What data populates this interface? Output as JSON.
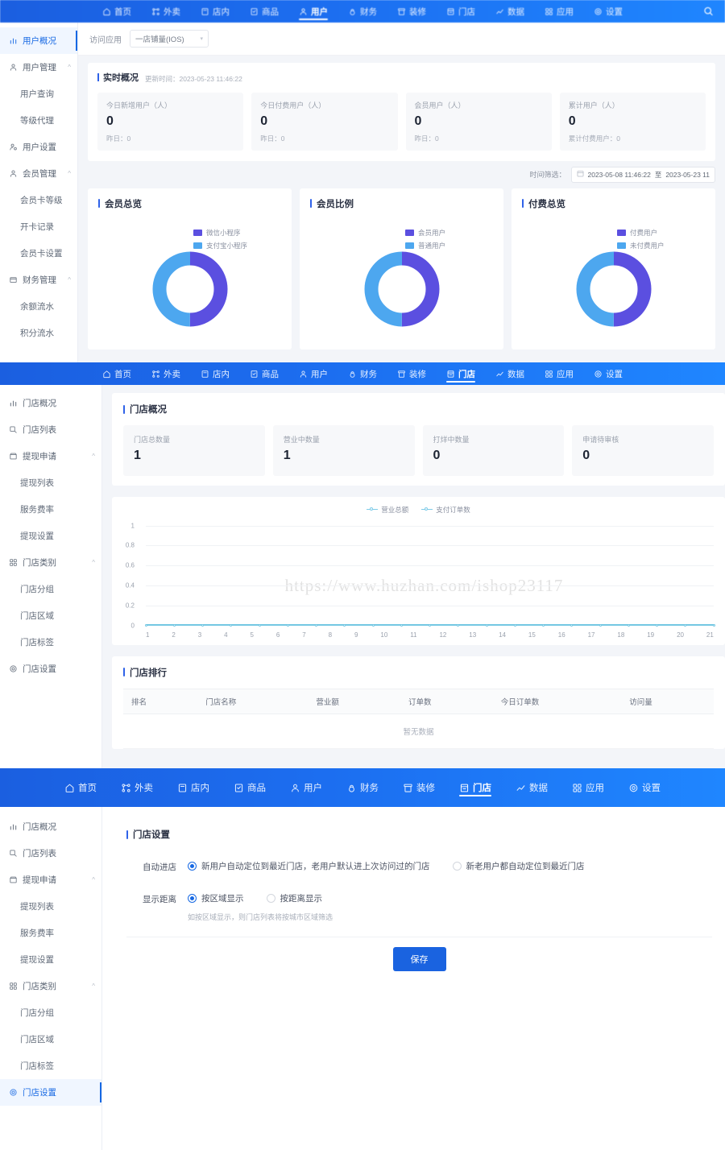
{
  "nav": {
    "items": [
      {
        "label": "首页",
        "icon": "home-icon"
      },
      {
        "label": "外卖",
        "icon": "takeout-icon"
      },
      {
        "label": "店内",
        "icon": "instore-icon"
      },
      {
        "label": "商品",
        "icon": "goods-icon"
      },
      {
        "label": "用户",
        "icon": "user-icon"
      },
      {
        "label": "财务",
        "icon": "finance-icon"
      },
      {
        "label": "装修",
        "icon": "decorate-icon"
      },
      {
        "label": "门店",
        "icon": "store-icon"
      },
      {
        "label": "数据",
        "icon": "data-icon"
      },
      {
        "label": "应用",
        "icon": "apps-icon"
      },
      {
        "label": "设置",
        "icon": "gear-icon"
      }
    ],
    "search_icon": "search-icon"
  },
  "panel1": {
    "active_nav": "用户",
    "sidebar": [
      {
        "label": "用户概况",
        "icon": "overview-icon",
        "level": "top",
        "active": true
      },
      {
        "label": "用户管理",
        "icon": "users-icon",
        "level": "top",
        "caret": "^"
      },
      {
        "label": "用户查询",
        "level": "child"
      },
      {
        "label": "等级代理",
        "level": "child"
      },
      {
        "label": "用户设置",
        "icon": "user-setting-icon",
        "level": "top"
      },
      {
        "label": "会员管理",
        "icon": "vip-icon",
        "level": "top",
        "caret": "^"
      },
      {
        "label": "会员卡等级",
        "level": "child"
      },
      {
        "label": "开卡记录",
        "level": "child"
      },
      {
        "label": "会员卡设置",
        "level": "child"
      },
      {
        "label": "财务管理",
        "icon": "finance-side-icon",
        "level": "top",
        "caret": "^"
      },
      {
        "label": "余额流水",
        "level": "child"
      },
      {
        "label": "积分流水",
        "level": "child"
      }
    ],
    "filter": {
      "label": "访问应用",
      "value": "一店铺量(IOS)"
    },
    "realtime": {
      "title": "实时概况",
      "updated": "更新时间：2023-05-23 11:46:22",
      "cards": [
        {
          "label": "今日新增用户（人）",
          "value": "0",
          "sub": "昨日：0"
        },
        {
          "label": "今日付费用户（人）",
          "value": "0",
          "sub": "昨日：0"
        },
        {
          "label": "会员用户（人）",
          "value": "0",
          "sub": "昨日：0"
        },
        {
          "label": "累计用户（人）",
          "value": "0",
          "sub": "累计付费用户：0"
        }
      ]
    },
    "timefilter": {
      "label": "时间筛选：",
      "start": "2023-05-08 11:46:22",
      "sep": "至",
      "end": "2023-05-23 11"
    },
    "donuts": [
      {
        "title": "会员总览",
        "legend": [
          {
            "label": "微信小程序",
            "color": "#5b4fe0"
          },
          {
            "label": "支付宝小程序",
            "color": "#4da7ef"
          }
        ],
        "values": [
          50,
          50
        ]
      },
      {
        "title": "会员比例",
        "legend": [
          {
            "label": "会员用户",
            "color": "#5b4fe0"
          },
          {
            "label": "普通用户",
            "color": "#4da7ef"
          }
        ],
        "values": [
          50,
          50
        ]
      },
      {
        "title": "付费总览",
        "legend": [
          {
            "label": "付费用户",
            "color": "#5b4fe0"
          },
          {
            "label": "未付费用户",
            "color": "#4da7ef"
          }
        ],
        "values": [
          50,
          50
        ]
      }
    ]
  },
  "panel2": {
    "active_nav": "门店",
    "sidebar": [
      {
        "label": "门店概况",
        "icon": "overview-icon",
        "level": "top"
      },
      {
        "label": "门店列表",
        "icon": "list-icon",
        "level": "top"
      },
      {
        "label": "提现申请",
        "icon": "withdraw-icon",
        "level": "top",
        "caret": "^"
      },
      {
        "label": "提现列表",
        "level": "child"
      },
      {
        "label": "服务费率",
        "level": "child"
      },
      {
        "label": "提现设置",
        "level": "child"
      },
      {
        "label": "门店类别",
        "icon": "category-icon",
        "level": "top",
        "caret": "^"
      },
      {
        "label": "门店分组",
        "level": "child"
      },
      {
        "label": "门店区域",
        "level": "child"
      },
      {
        "label": "门店标签",
        "level": "child"
      },
      {
        "label": "门店设置",
        "icon": "gear-icon",
        "level": "top"
      }
    ],
    "overview": {
      "title": "门店概况",
      "cards": [
        {
          "label": "门店总数量",
          "value": "1"
        },
        {
          "label": "营业中数量",
          "value": "1"
        },
        {
          "label": "打烊中数量",
          "value": "0"
        },
        {
          "label": "申请待审核",
          "value": "0"
        }
      ]
    },
    "watermark": "https://www.huzhan.com/ishop23117",
    "ranking": {
      "title": "门店排行",
      "columns": [
        "排名",
        "门店名称",
        "营业额",
        "订单数",
        "今日订单数",
        "访问量"
      ],
      "empty_text": "暂无数据"
    }
  },
  "panel3": {
    "active_nav": "门店",
    "sidebar": [
      {
        "label": "门店概况",
        "icon": "overview-icon",
        "level": "top"
      },
      {
        "label": "门店列表",
        "icon": "list-icon",
        "level": "top"
      },
      {
        "label": "提现申请",
        "icon": "withdraw-icon",
        "level": "top",
        "caret": "^"
      },
      {
        "label": "提现列表",
        "level": "child"
      },
      {
        "label": "服务费率",
        "level": "child"
      },
      {
        "label": "提现设置",
        "level": "child"
      },
      {
        "label": "门店类别",
        "icon": "category-icon",
        "level": "top",
        "caret": "^"
      },
      {
        "label": "门店分组",
        "level": "child"
      },
      {
        "label": "门店区域",
        "level": "child"
      },
      {
        "label": "门店标签",
        "level": "child"
      },
      {
        "label": "门店设置",
        "icon": "gear-icon",
        "level": "top",
        "active": true
      }
    ],
    "form": {
      "title": "门店设置",
      "auto_enter": {
        "label": "自动进店",
        "options": [
          {
            "label": "新用户自动定位到最近门店，老用户默认进上次访问过的门店",
            "selected": true
          },
          {
            "label": "新老用户都自动定位到最近门店",
            "selected": false
          }
        ]
      },
      "show_distance": {
        "label": "显示距离",
        "options": [
          {
            "label": "按区域显示",
            "selected": true
          },
          {
            "label": "按距离显示",
            "selected": false
          }
        ],
        "hint": "如按区域显示，则门店列表将按城市区域筛选"
      },
      "save_label": "保存"
    }
  },
  "chart_data": {
    "type": "line",
    "title": "",
    "xlabel": "",
    "ylabel": "",
    "x": [
      1,
      2,
      3,
      4,
      5,
      6,
      7,
      8,
      9,
      10,
      11,
      12,
      13,
      14,
      15,
      16,
      17,
      18,
      19,
      20,
      21
    ],
    "ylim": [
      0,
      1
    ],
    "yticks": [
      0,
      0.2,
      0.4,
      0.6,
      0.8,
      1
    ],
    "grid": true,
    "legend_position": "top",
    "series": [
      {
        "name": "营业总额",
        "color": "#7ecbe8",
        "values": [
          0,
          0,
          0,
          0,
          0,
          0,
          0,
          0,
          0,
          0,
          0,
          0,
          0,
          0,
          0,
          0,
          0,
          0,
          0,
          0,
          0
        ]
      },
      {
        "name": "支付订单数",
        "color": "#7ecbe8",
        "values": [
          0,
          0,
          0,
          0,
          0,
          0,
          0,
          0,
          0,
          0,
          0,
          0,
          0,
          0,
          0,
          0,
          0,
          0,
          0,
          0,
          0
        ]
      }
    ]
  },
  "colors": {
    "brand": "#1668e3",
    "purple": "#5b4fe0",
    "blue": "#4da7ef",
    "cyan": "#7ecbe8"
  }
}
